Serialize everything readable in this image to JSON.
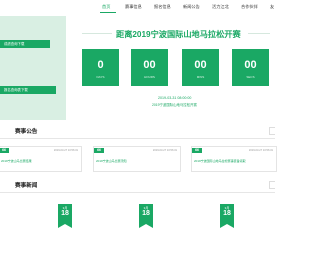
{
  "nav": {
    "items": [
      "首页",
      "赛事信息",
      "报名信息",
      "新闻公告",
      "活力江北",
      "合作伙伴",
      "友"
    ],
    "active_index": 0
  },
  "hero": {
    "side_buttons": [
      "成绩查询下载",
      "报名查询表下载"
    ],
    "title": "距离2019宁波国际山地马拉松开赛",
    "countdown": [
      {
        "value": "0",
        "label": "DAYS"
      },
      {
        "value": "00",
        "label": "HOURS"
      },
      {
        "value": "00",
        "label": "MINS"
      },
      {
        "value": "00",
        "label": "SECS"
      }
    ],
    "date": "2019-03-31 08:00:00",
    "subtitle": "2019宁波国际山地马拉松开赛"
  },
  "notices": {
    "title": "赛事公告",
    "cards": [
      {
        "tag": "66",
        "date": "2019-03-27 10:56:31",
        "text": "2019宁波山马比赛结果"
      },
      {
        "tag": "66",
        "date": "2019-03-27 10:56:31",
        "text": "2019宁波山马比赛须知"
      },
      {
        "tag": "66",
        "date": "2019-03-27 10:56:31",
        "text": "2019宁波国际山地马拉松赛事装备领取"
      }
    ]
  },
  "news": {
    "title": "赛事新闻",
    "badges": [
      {
        "month": "3月",
        "day": "18"
      },
      {
        "month": "3月",
        "day": "18"
      },
      {
        "month": "3月",
        "day": "18"
      }
    ]
  },
  "colors": {
    "accent": "#1aa864",
    "hero_side": "#d9efe3"
  }
}
